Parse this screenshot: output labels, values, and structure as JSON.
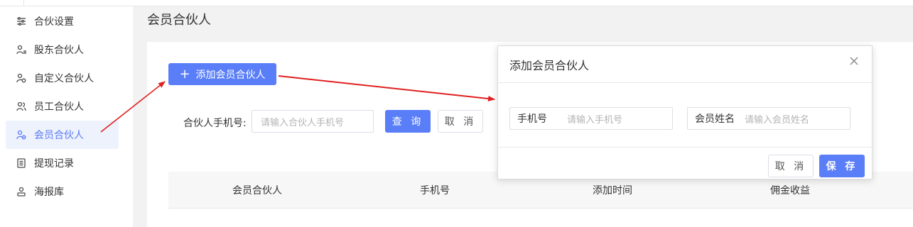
{
  "sidebar": {
    "items": [
      {
        "label": "合伙设置",
        "icon": "sliders-icon",
        "active": false
      },
      {
        "label": "股东合伙人",
        "icon": "users-icon",
        "active": false
      },
      {
        "label": "自定义合伙人",
        "icon": "user-gear-icon",
        "active": false
      },
      {
        "label": "员工合伙人",
        "icon": "users-icon",
        "active": false
      },
      {
        "label": "会员合伙人",
        "icon": "user-link-icon",
        "active": true
      },
      {
        "label": "提现记录",
        "icon": "document-icon",
        "active": false
      },
      {
        "label": "海报库",
        "icon": "user-card-icon",
        "active": false
      }
    ]
  },
  "page": {
    "title": "会员合伙人"
  },
  "toolbar": {
    "add_label": "添加会员合伙人",
    "add_icon": "plus-icon"
  },
  "filter": {
    "phone_label": "合伙人手机号:",
    "phone_placeholder": "请输入合伙人手机号",
    "query_label": "查 询",
    "cancel_label": "取 消"
  },
  "table": {
    "columns": [
      "会员合伙人",
      "手机号",
      "添加时间",
      "佣金收益"
    ]
  },
  "modal": {
    "title": "添加会员合伙人",
    "close_icon": "close-icon",
    "fields": [
      {
        "label": "手机号",
        "placeholder": "请输入手机号"
      },
      {
        "label": "会员姓名",
        "placeholder": "请输入会员姓名"
      }
    ],
    "cancel_label": "取 消",
    "save_label": "保 存"
  },
  "colors": {
    "primary": "#5a7ef7",
    "annotation_arrow": "#e02020",
    "active_bg": "#eef2fc"
  }
}
